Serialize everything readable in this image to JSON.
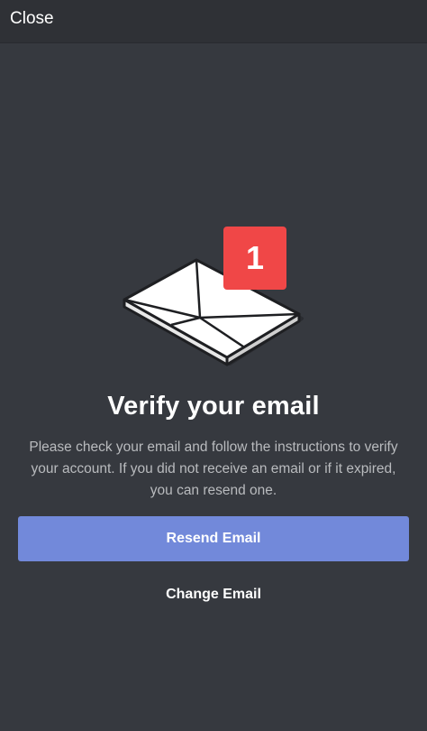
{
  "header": {
    "close_label": "Close"
  },
  "illustration": {
    "icon": "envelope-icon",
    "badge_count": "1",
    "badge_color": "#f04747"
  },
  "main": {
    "title": "Verify your email",
    "description": "Please check your email and follow the instructions to verify your account.  If you did not receive an email or if it expired, you can resend one.",
    "resend_label": "Resend Email",
    "change_label": "Change Email"
  },
  "colors": {
    "background": "#36393f",
    "header_bg": "#2f3136",
    "accent": "#7289da",
    "text_muted": "#b9bbbe"
  }
}
